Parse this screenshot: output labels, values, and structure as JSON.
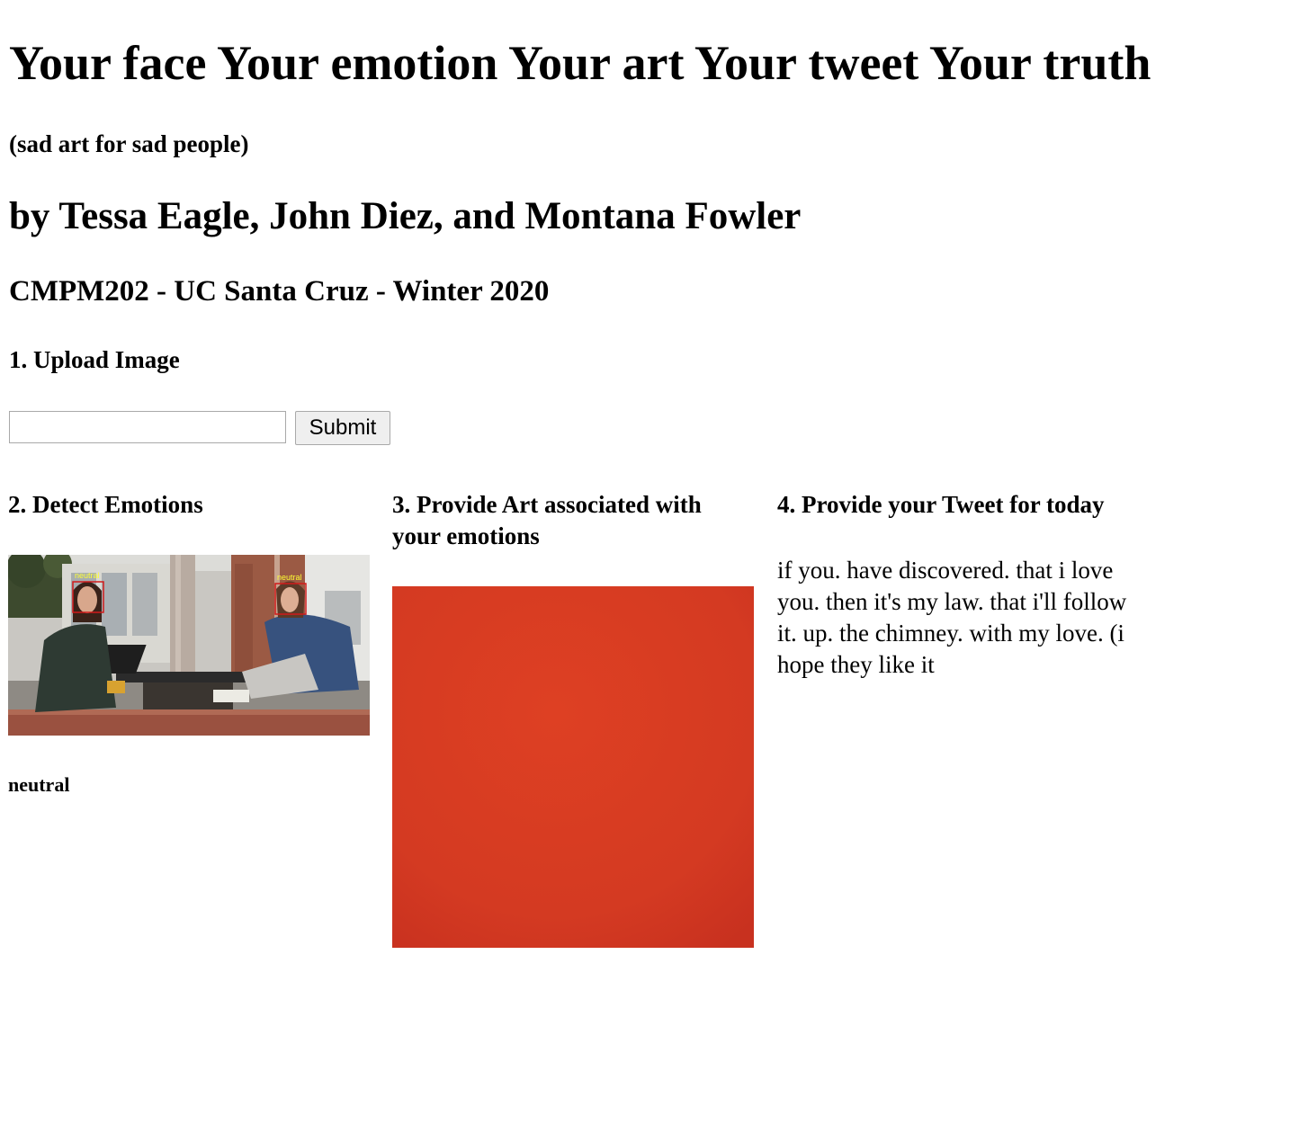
{
  "header": {
    "title": "Your face Your emotion Your art Your tweet Your truth",
    "subtitle": "(sad art for sad people)",
    "authors": "by Tessa Eagle, John Diez, and Montana Fowler",
    "course": "CMPM202 - UC Santa Cruz - Winter 2020"
  },
  "upload": {
    "heading": "1. Upload Image",
    "input_value": "",
    "submit_label": "Submit"
  },
  "detect": {
    "heading": "2. Detect Emotions",
    "face_labels": [
      "neutral",
      "neutral"
    ],
    "result": "neutral"
  },
  "art": {
    "heading": "3. Provide Art associated with your emotions",
    "color": "#d63a22"
  },
  "tweet": {
    "heading": "4. Provide your Tweet for today",
    "text": "if you. have discovered. that i love you. then it's my law. that i'll follow it. up. the chimney. with my love. (i hope they like it"
  },
  "colors": {
    "face_box": "#d11a1a",
    "face_label": "#ffff33",
    "art_red": "#d63a22"
  }
}
